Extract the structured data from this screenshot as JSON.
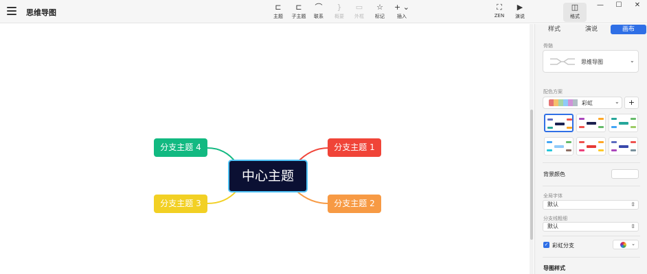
{
  "app": {
    "title": "思维导图",
    "toolbar": [
      {
        "key": "topic",
        "icon": "topic-icon",
        "glyph": "⊏",
        "label": "主题",
        "enabled": true
      },
      {
        "key": "subtopic",
        "icon": "subtopic-icon",
        "glyph": "⊏",
        "label": "子主题",
        "enabled": true
      },
      {
        "key": "relation",
        "icon": "relation-icon",
        "glyph": "⌒",
        "label": "联系",
        "enabled": true
      },
      {
        "key": "summary",
        "icon": "summary-icon",
        "glyph": "}",
        "label": "概要",
        "enabled": false
      },
      {
        "key": "boundary",
        "icon": "boundary-icon",
        "glyph": "▭",
        "label": "外框",
        "enabled": false
      },
      {
        "key": "marker",
        "icon": "star-icon",
        "glyph": "☆",
        "label": "标记",
        "enabled": true
      },
      {
        "key": "insert",
        "icon": "plus-icon",
        "glyph": "+ ⌄",
        "label": "插入",
        "enabled": true
      },
      {
        "key": "zen",
        "icon": "fullscreen-icon",
        "glyph": "⛶",
        "label": "ZEN",
        "enabled": true
      },
      {
        "key": "present",
        "icon": "play-icon",
        "glyph": "▶",
        "label": "演说",
        "enabled": true
      },
      {
        "key": "format",
        "icon": "format-panel-icon",
        "glyph": "◫",
        "label": "格式",
        "enabled": true
      }
    ],
    "window_controls": {
      "minimize": "—",
      "maximize": "☐",
      "close": "✕"
    }
  },
  "mindmap": {
    "central": {
      "text": "中心主题",
      "fill": "#0b1033",
      "border": "#4fc3f7"
    },
    "branches": [
      {
        "text": "分支主题 1",
        "color": "#f04438"
      },
      {
        "text": "分支主题 2",
        "color": "#f79a44"
      },
      {
        "text": "分支主题 3",
        "color": "#f2d024"
      },
      {
        "text": "分支主题 4",
        "color": "#12b981"
      }
    ]
  },
  "panel": {
    "tabs": [
      "样式",
      "演说",
      "画布"
    ],
    "active_tab": "画布",
    "skeleton": {
      "label": "骨骼",
      "value": "思维导图"
    },
    "color_scheme": {
      "label": "配色方案",
      "value": "彩虹",
      "swatch_colors": [
        "#e57373",
        "#f6c06b",
        "#a5d6a7",
        "#90caf9",
        "#ce93d8",
        "#b0bec5"
      ]
    },
    "background_color": {
      "label": "背景颜色"
    },
    "global_font": {
      "label": "全局字体",
      "value": "默认"
    },
    "branch_thickness": {
      "label": "分支线粗细",
      "value": "默认"
    },
    "rainbow_branch": {
      "label": "彩虹分支",
      "checked": true
    },
    "map_style": {
      "label": "导图样式"
    }
  }
}
